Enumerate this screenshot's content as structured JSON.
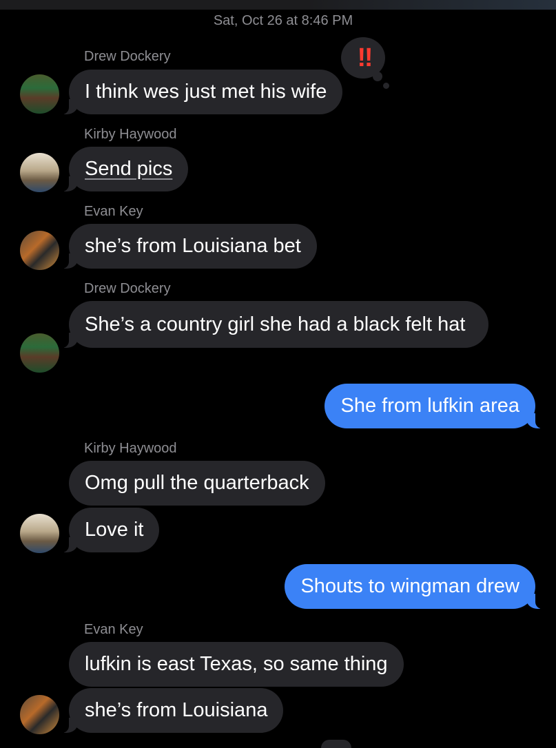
{
  "timestamp": "Sat, Oct 26 at 8:46 PM",
  "messages": [
    {
      "sender": "Drew Dockery",
      "text": "I think wes just met his wife",
      "reaction": "‼"
    },
    {
      "sender": "Kirby Haywood",
      "text": "Send pics"
    },
    {
      "sender": "Evan Key",
      "text": "she’s from Louisiana bet"
    },
    {
      "sender": "Drew Dockery",
      "text": "She’s a country girl she had a black felt hat"
    },
    {
      "outgoing": true,
      "text": "She from lufkin area"
    },
    {
      "sender": "Kirby Haywood",
      "text": "Omg pull the quarterback"
    },
    {
      "text": "Love it"
    },
    {
      "outgoing": true,
      "text": "Shouts to wingman drew"
    },
    {
      "sender": "Evan Key",
      "text": "lufkin is east Texas, so same thing"
    },
    {
      "text": "she’s from Louisiana"
    }
  ],
  "colors": {
    "background": "#000000",
    "incoming_bubble": "#26262a",
    "outgoing_bubble": "#3b82f6",
    "meta_text": "#8e8e93",
    "reaction": "#ff3b30"
  },
  "icons": {
    "reaction": "double-exclamation-icon"
  }
}
